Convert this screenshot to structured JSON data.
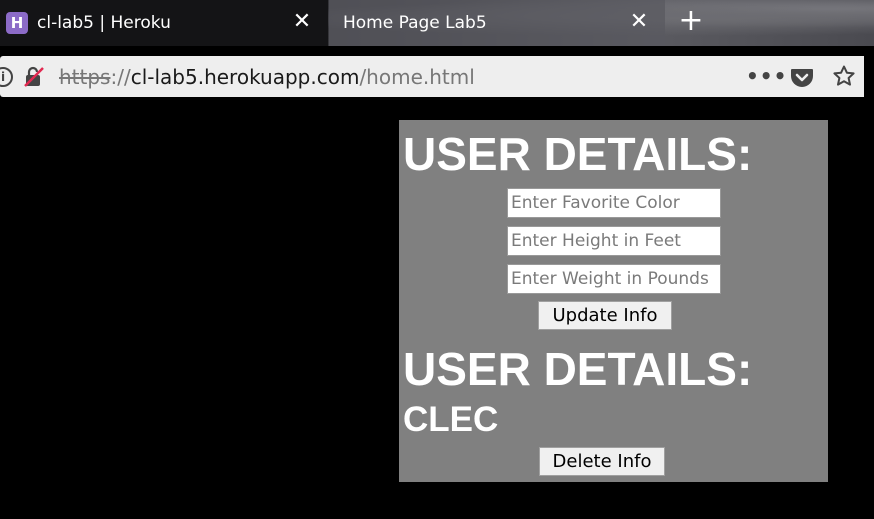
{
  "browser": {
    "tabs": [
      {
        "title": "cl-lab5 | Heroku",
        "favicon": "heroku-logo",
        "active": false
      },
      {
        "title": "Home Page Lab5",
        "active": true
      }
    ],
    "new_tab_label": "+",
    "url": {
      "scheme": "https",
      "separator": "://",
      "host": "cl-lab5.herokuapp.com",
      "path": "/home.html"
    },
    "page_actions_label": "•••"
  },
  "page": {
    "heading_top": "USER DETAILS:",
    "color_field": {
      "placeholder": "Enter Favorite Color",
      "value": ""
    },
    "height_field": {
      "placeholder": "Enter Height in Feet",
      "value": ""
    },
    "weight_field": {
      "placeholder": "Enter Weight in Pounds",
      "value": ""
    },
    "update_button": "Update Info",
    "heading_bottom": "USER DETAILS:",
    "username": "CLEC",
    "delete_button": "Delete Info"
  },
  "colors": {
    "panel_bg": "#808080",
    "page_bg": "#000000",
    "heading_text": "#ffffff",
    "favicon_purple": "#8c6bc7"
  }
}
